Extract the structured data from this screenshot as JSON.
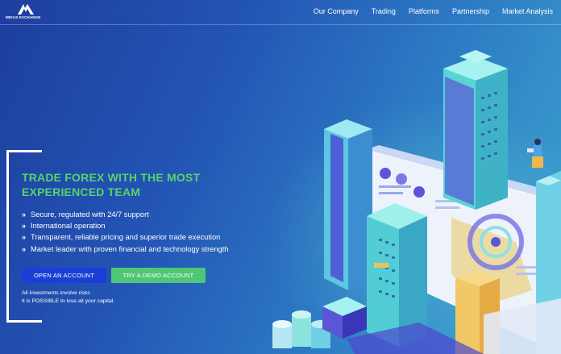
{
  "brand": {
    "name": "MIDAS EXCHANGE",
    "logo_icon": "midas-m-logo-icon"
  },
  "nav": {
    "items": [
      {
        "label": "Our Company"
      },
      {
        "label": "Trading"
      },
      {
        "label": "Platforms"
      },
      {
        "label": "Partnership"
      },
      {
        "label": "Market Analysis"
      }
    ]
  },
  "hero": {
    "headline_line1": "TRADE FOREX WITH THE MOST",
    "headline_line2": "EXPERIENCED TEAM",
    "features": [
      "Secure, regulated with 24/7 support",
      "International operation",
      "Transparent, reliable pricing and superior trade execution",
      "Market leader with proven financial and technology strength"
    ],
    "bullet_glyph": "»",
    "open_account_label": "OPEN AN ACCOUNT",
    "demo_account_label": "TRY A DEMO ACCOUNT",
    "disclaimer_line1": "All investments involve risks",
    "disclaimer_line2": "It is POSSIBLE to lose all your capital."
  },
  "colors": {
    "headline": "#57d46a",
    "open_button": "#1a3fd6",
    "demo_button": "#4fc774",
    "background_start": "#1d3e9e",
    "background_end": "#3ea6cf"
  }
}
